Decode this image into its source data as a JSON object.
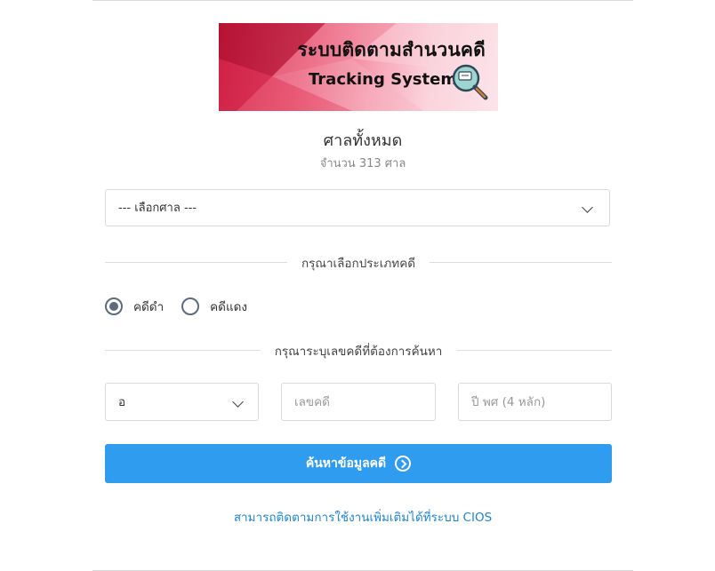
{
  "banner": {
    "title_th": "ระบบติดตามสำนวนคดี",
    "title_en": "Tracking System"
  },
  "header": {
    "title": "ศาลทั้งหมด",
    "count_text": "จำนวน 313 ศาล"
  },
  "court_select": {
    "selected": "--- เลือกศาล ---"
  },
  "case_type": {
    "heading": "กรุณาเลือกประเภทคดี",
    "options": [
      {
        "label": "คดีดำ",
        "selected": true
      },
      {
        "label": "คดีแดง",
        "selected": false
      }
    ]
  },
  "case_number": {
    "heading": "กรุณาระบุเลขคดีที่ต้องการค้นหา",
    "prefix_value": "อ",
    "number_placeholder": "เลขคดี",
    "year_placeholder": "ปี พศ (4 หลัก)"
  },
  "search_button": {
    "label": "ค้นหาข้อมูลคดี"
  },
  "footer_link": {
    "label": "สามารถติดตามการใช้งานเพิ่มเติมได้ที่ระบบ CIOS"
  },
  "icons": [
    "chevron-down-icon",
    "magnifier-icon",
    "arrow-circle-right-icon"
  ],
  "colors": {
    "primary": "#2f9cef",
    "link": "#1f86d4",
    "radio": "#5d6c7c"
  }
}
